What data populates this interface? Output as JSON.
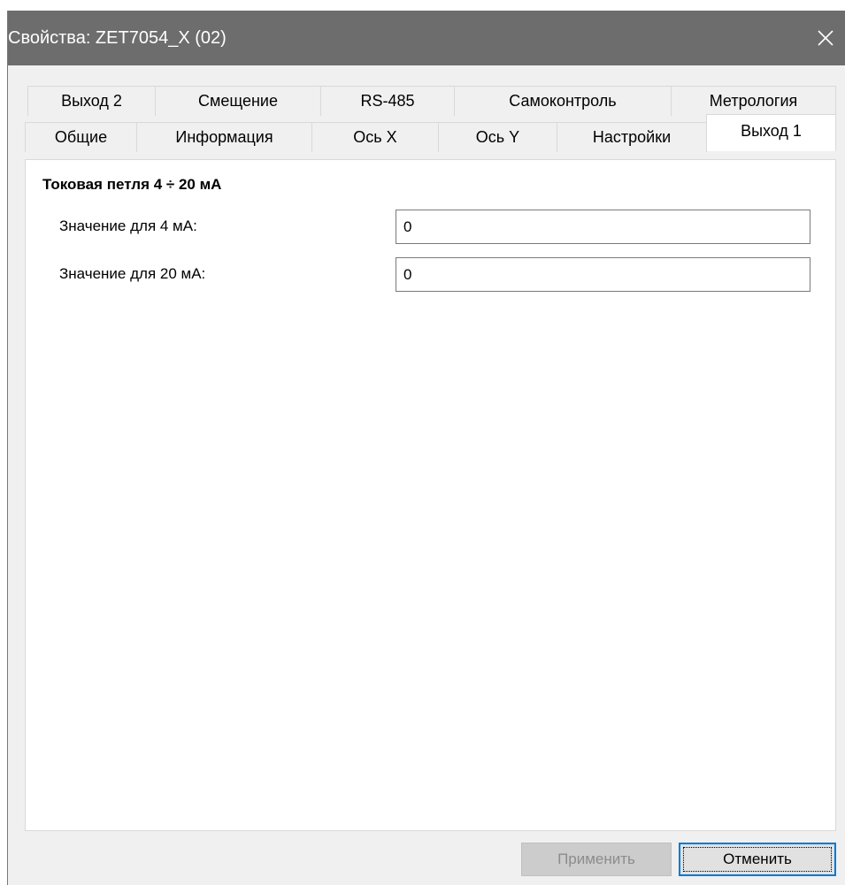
{
  "window": {
    "title": "Свойства: ZET7054_X (02)"
  },
  "tabs": {
    "back_row": [
      {
        "label": "Выход 2"
      },
      {
        "label": "Смещение"
      },
      {
        "label": "RS-485"
      },
      {
        "label": "Самоконтроль"
      },
      {
        "label": "Метрология"
      }
    ],
    "front_row": [
      {
        "label": "Общие"
      },
      {
        "label": "Информация"
      },
      {
        "label": "Ось X"
      },
      {
        "label": "Ось Y"
      },
      {
        "label": "Настройки"
      },
      {
        "label": "Выход 1"
      }
    ],
    "active": "Выход 1"
  },
  "panel": {
    "group_title": "Токовая петля 4 ÷ 20 мА",
    "fields": [
      {
        "label": "Значение для 4 мА:",
        "value": "0"
      },
      {
        "label": "Значение для 20 мА:",
        "value": "0"
      }
    ]
  },
  "buttons": {
    "apply_label": "Применить",
    "cancel_label": "Отменить"
  },
  "icons": {
    "close": "close-icon"
  },
  "colors": {
    "titlebar": "#6d6d6d",
    "focus_border": "#0078d7",
    "disabled_text": "#8c8c8c"
  }
}
